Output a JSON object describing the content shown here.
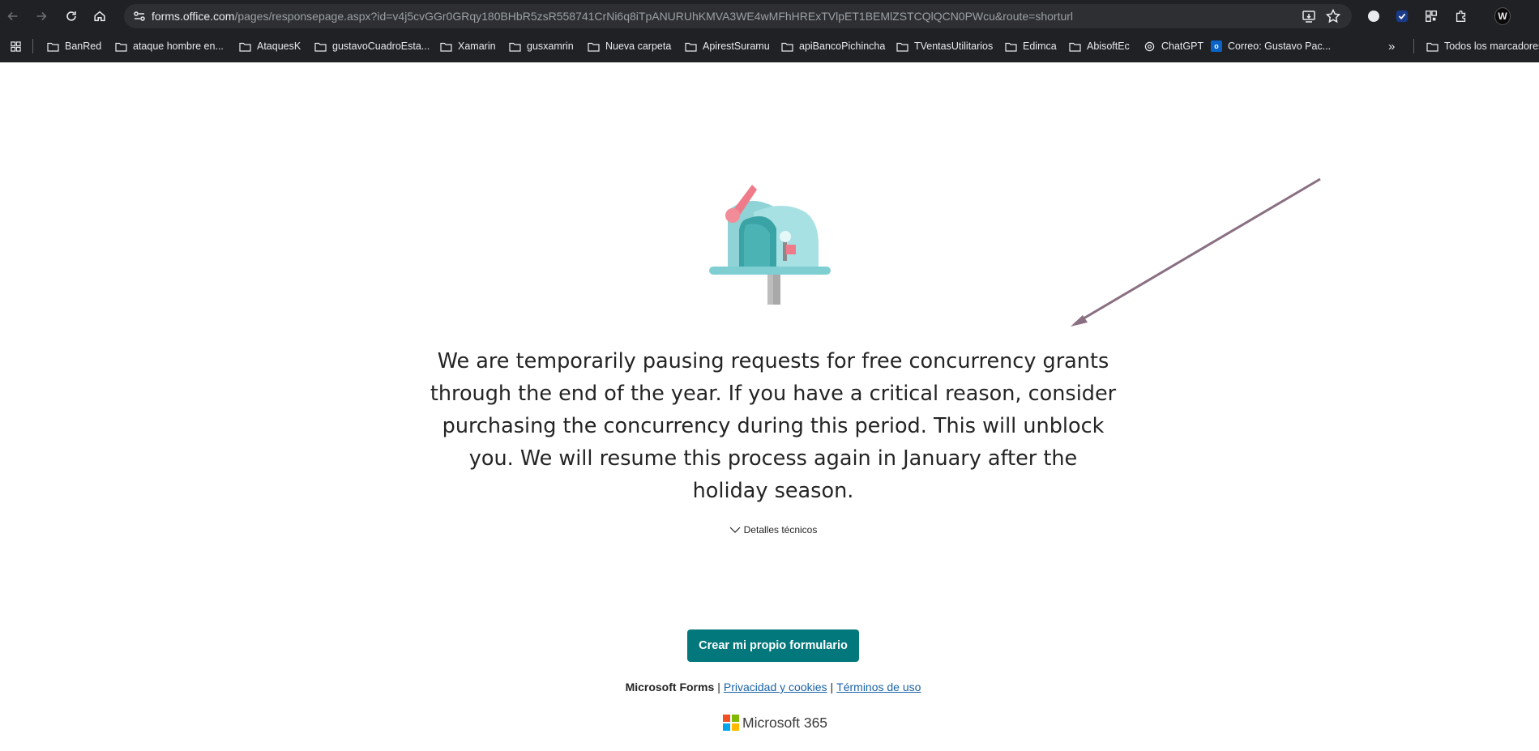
{
  "browser": {
    "url_host": "forms.office.com",
    "url_rest": "/pages/responsepage.aspx?id=v4j5cvGGr0GRqy180BHbR5zsR558741CrNi6q8iTpANURUhKMVA3WE4wMFhHRExTVlpET1BEMlZSTCQlQCN0PWcu&route=shorturl",
    "bookmarks": [
      {
        "label": "BanRed",
        "icon": "folder-icon"
      },
      {
        "label": "ataque hombre en...",
        "icon": "folder-icon"
      },
      {
        "label": "AtaquesK",
        "icon": "folder-icon"
      },
      {
        "label": "gustavoCuadroEsta...",
        "icon": "folder-icon"
      },
      {
        "label": "Xamarin",
        "icon": "folder-icon"
      },
      {
        "label": "gusxamrin",
        "icon": "folder-icon"
      },
      {
        "label": "Nueva carpeta",
        "icon": "folder-icon"
      },
      {
        "label": "ApirestSuramu",
        "icon": "folder-icon"
      },
      {
        "label": "apiBancoPichincha",
        "icon": "folder-icon"
      },
      {
        "label": "TVentasUtilitarios",
        "icon": "folder-icon"
      },
      {
        "label": "Edimca",
        "icon": "folder-icon"
      },
      {
        "label": "AbisoftEc",
        "icon": "folder-icon"
      },
      {
        "label": "ChatGPT",
        "icon": "chatgpt-icon"
      },
      {
        "label": "Correo: Gustavo Pac...",
        "icon": "outlook-icon"
      }
    ],
    "all_bookmarks": "Todos los marcadores"
  },
  "page": {
    "message": "We are temporarily pausing requests for free concurrency grants through the end of the year. If you have a critical reason, consider purchasing the concurrency during this period. This will unblock you. We will resume this process again in January after the holiday season.",
    "tech_details": "Detalles técnicos",
    "create_button": "Crear mi propio formulario",
    "footer": {
      "brand": "Microsoft Forms",
      "privacy": "Privacidad y cookies",
      "terms": "Términos de uso",
      "separator": "|"
    },
    "logo_text": "Microsoft 365"
  },
  "colors": {
    "accent": "#03787c",
    "link": "#1a62a8",
    "chrome_bg": "#202124"
  }
}
